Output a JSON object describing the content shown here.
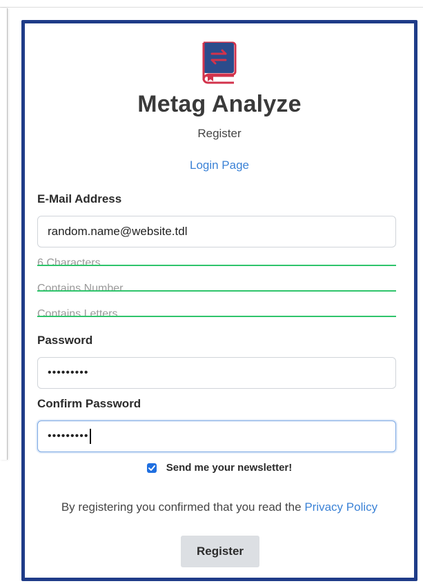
{
  "app": {
    "title": "Metag Analyze",
    "subtitle": "Register",
    "login_link": "Login Page",
    "logo_icon": "book-exchange-icon"
  },
  "form": {
    "email": {
      "label": "E-Mail Address",
      "value": "random.name@website.tdl"
    },
    "password_rules": [
      {
        "text": "6 Characters",
        "satisfied": true
      },
      {
        "text": "Contains Number",
        "satisfied": true
      },
      {
        "text": "Contains Letters",
        "satisfied": true
      }
    ],
    "password": {
      "label": "Password",
      "value": "•••••••••"
    },
    "confirm_password": {
      "label": "Confirm Password",
      "value": "•••••••••"
    },
    "newsletter": {
      "label": "Send me your newsletter!",
      "checked": true
    },
    "privacy": {
      "text": "By registering you confirmed that you read the",
      "link": "Privacy Policy"
    },
    "submit_label": "Register"
  },
  "colors": {
    "card_border": "#1f3c88",
    "link": "#3b82d6",
    "rule_strike": "#2ec46b",
    "logo_primary": "#d2334c",
    "logo_secondary": "#2b4c8c",
    "checkbox": "#1f6fe0"
  }
}
